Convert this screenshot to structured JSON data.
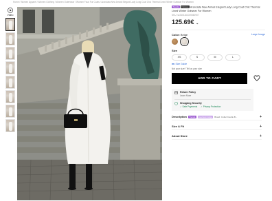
{
  "breadcrumb": [
    "Home",
    "Women Apparel",
    "Women Clothing",
    "Women Outerwear",
    "Women Faux Fur Coats",
    "Aranciata New Arrival Elegant Lady Long Coat Chic Thermal Lined Winter Outwear For Women"
  ],
  "thumbnails": {
    "video_label": "Video"
  },
  "product": {
    "badge_trends": "Trends",
    "badge_choices": "Choices",
    "title": "Aranciata New Arrival Elegant Lady Long Coat Chic Thermal Lined Winter Outwear For Women",
    "sku": "SKU: sz2401161039360907",
    "price": "125.69€",
    "price_arrow": "⌄",
    "color_prefix": "Color:",
    "color_value": "Beige",
    "large_image_link": "Large Image",
    "size_label": "Size",
    "sizes": [
      "XS",
      "S",
      "M",
      "L"
    ],
    "size_guide": "Size Guide",
    "fit_hint": "Not your size? Tell us your size",
    "add_to_cart": "ADD TO CART"
  },
  "policy": {
    "return_title": "Return Policy",
    "return_sub": "Learn More",
    "security_title": "Shopping Security",
    "security_safe": "✓ Safe Payments",
    "security_privacy": "✓ Privacy Protection"
  },
  "sections": {
    "description": "Description",
    "description_tag_trends": "Trends",
    "description_tag_outlet": "Aesthetic Edge",
    "description_desc": "Brand: Collar Double B...",
    "size_fit": "Size & Fit",
    "about_store": "About Store",
    "expand_symbol": "+"
  },
  "colors": {
    "accent": "#2f6bd8",
    "trends": "#9b59d0",
    "cta": "#000000",
    "security": "#198754"
  }
}
